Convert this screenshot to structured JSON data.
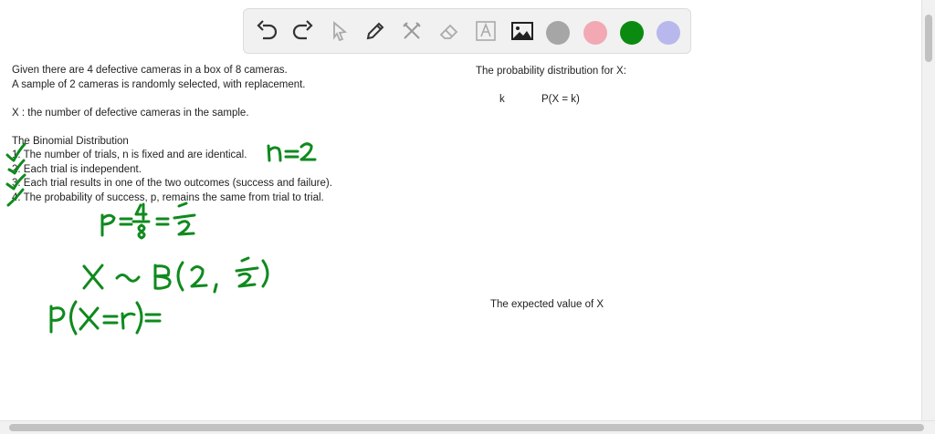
{
  "toolbar": {
    "tools": [
      "undo-icon",
      "redo-icon",
      "pointer-icon",
      "pen-icon",
      "tools-icon",
      "eraser-icon",
      "text-icon",
      "image-icon"
    ],
    "colors": [
      "#a6a6a6",
      "#f2a9b3",
      "#0b8a12",
      "#b8b8ec"
    ]
  },
  "problem": {
    "line1": "Given there are 4 defective cameras in a box of 8 cameras.",
    "line2": "A sample of 2 cameras is randomly selected, with replacement.",
    "line3": "X : the number of defective cameras in the sample.",
    "heading": "The Binomial Distribution",
    "cond1": "1. The number of trials, n is fixed and are identical.",
    "cond2": "2. Each trial is independent.",
    "cond3": "3. Each trial results in one of the two outcomes (success and failure).",
    "cond4": "4. The probability of success, p, remains the same from trial to trial."
  },
  "right_panel": {
    "dist_title": "The probability distribution for X:",
    "col_k": "k",
    "col_p": "P(X = k)",
    "expected": "The expected value of X"
  },
  "handwriting": {
    "n_value": "n=2",
    "p_value": "p = 4/8 = 1/2",
    "distribution": "X ~ B(2, 1/2)",
    "pmf": "P(X=r)="
  }
}
